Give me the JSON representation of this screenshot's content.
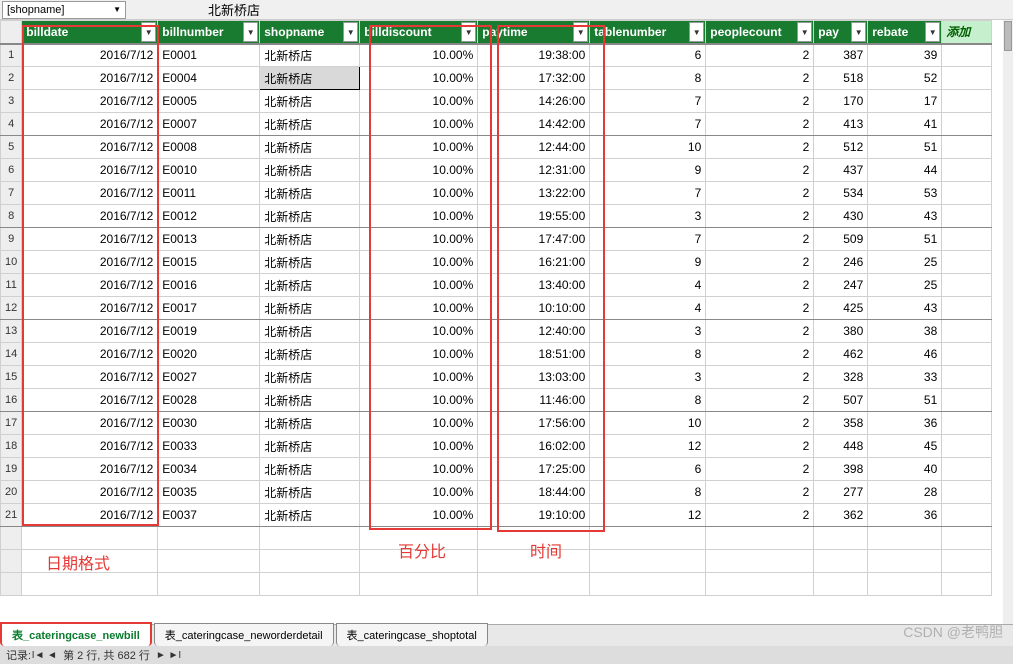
{
  "namebox": "[shopname]",
  "formula_value": "北新桥店",
  "columns": [
    {
      "key": "billdate",
      "label": "billdate"
    },
    {
      "key": "billnumber",
      "label": "billnumber"
    },
    {
      "key": "shopname",
      "label": "shopname"
    },
    {
      "key": "billdiscount",
      "label": "billdiscount"
    },
    {
      "key": "paytime",
      "label": "paytime"
    },
    {
      "key": "tablenumber",
      "label": "tablenumber"
    },
    {
      "key": "peoplecount",
      "label": "peoplecount"
    },
    {
      "key": "pay",
      "label": "pay"
    },
    {
      "key": "rebate",
      "label": "rebate"
    }
  ],
  "extra_col": "添加",
  "rows": [
    {
      "n": 1,
      "billdate": "2016/7/12",
      "billnumber": "E0001",
      "shopname": "北新桥店",
      "billdiscount": "10.00%",
      "paytime": "19:38:00",
      "tablenumber": "6",
      "peoplecount": "2",
      "pay": "387",
      "rebate": "39"
    },
    {
      "n": 2,
      "billdate": "2016/7/12",
      "billnumber": "E0004",
      "shopname": "北新桥店",
      "billdiscount": "10.00%",
      "paytime": "17:32:00",
      "tablenumber": "8",
      "peoplecount": "2",
      "pay": "518",
      "rebate": "52"
    },
    {
      "n": 3,
      "billdate": "2016/7/12",
      "billnumber": "E0005",
      "shopname": "北新桥店",
      "billdiscount": "10.00%",
      "paytime": "14:26:00",
      "tablenumber": "7",
      "peoplecount": "2",
      "pay": "170",
      "rebate": "17"
    },
    {
      "n": 4,
      "billdate": "2016/7/12",
      "billnumber": "E0007",
      "shopname": "北新桥店",
      "billdiscount": "10.00%",
      "paytime": "14:42:00",
      "tablenumber": "7",
      "peoplecount": "2",
      "pay": "413",
      "rebate": "41"
    },
    {
      "n": 5,
      "billdate": "2016/7/12",
      "billnumber": "E0008",
      "shopname": "北新桥店",
      "billdiscount": "10.00%",
      "paytime": "12:44:00",
      "tablenumber": "10",
      "peoplecount": "2",
      "pay": "512",
      "rebate": "51"
    },
    {
      "n": 6,
      "billdate": "2016/7/12",
      "billnumber": "E0010",
      "shopname": "北新桥店",
      "billdiscount": "10.00%",
      "paytime": "12:31:00",
      "tablenumber": "9",
      "peoplecount": "2",
      "pay": "437",
      "rebate": "44"
    },
    {
      "n": 7,
      "billdate": "2016/7/12",
      "billnumber": "E0011",
      "shopname": "北新桥店",
      "billdiscount": "10.00%",
      "paytime": "13:22:00",
      "tablenumber": "7",
      "peoplecount": "2",
      "pay": "534",
      "rebate": "53"
    },
    {
      "n": 8,
      "billdate": "2016/7/12",
      "billnumber": "E0012",
      "shopname": "北新桥店",
      "billdiscount": "10.00%",
      "paytime": "19:55:00",
      "tablenumber": "3",
      "peoplecount": "2",
      "pay": "430",
      "rebate": "43"
    },
    {
      "n": 9,
      "billdate": "2016/7/12",
      "billnumber": "E0013",
      "shopname": "北新桥店",
      "billdiscount": "10.00%",
      "paytime": "17:47:00",
      "tablenumber": "7",
      "peoplecount": "2",
      "pay": "509",
      "rebate": "51"
    },
    {
      "n": 10,
      "billdate": "2016/7/12",
      "billnumber": "E0015",
      "shopname": "北新桥店",
      "billdiscount": "10.00%",
      "paytime": "16:21:00",
      "tablenumber": "9",
      "peoplecount": "2",
      "pay": "246",
      "rebate": "25"
    },
    {
      "n": 11,
      "billdate": "2016/7/12",
      "billnumber": "E0016",
      "shopname": "北新桥店",
      "billdiscount": "10.00%",
      "paytime": "13:40:00",
      "tablenumber": "4",
      "peoplecount": "2",
      "pay": "247",
      "rebate": "25"
    },
    {
      "n": 12,
      "billdate": "2016/7/12",
      "billnumber": "E0017",
      "shopname": "北新桥店",
      "billdiscount": "10.00%",
      "paytime": "10:10:00",
      "tablenumber": "4",
      "peoplecount": "2",
      "pay": "425",
      "rebate": "43"
    },
    {
      "n": 13,
      "billdate": "2016/7/12",
      "billnumber": "E0019",
      "shopname": "北新桥店",
      "billdiscount": "10.00%",
      "paytime": "12:40:00",
      "tablenumber": "3",
      "peoplecount": "2",
      "pay": "380",
      "rebate": "38"
    },
    {
      "n": 14,
      "billdate": "2016/7/12",
      "billnumber": "E0020",
      "shopname": "北新桥店",
      "billdiscount": "10.00%",
      "paytime": "18:51:00",
      "tablenumber": "8",
      "peoplecount": "2",
      "pay": "462",
      "rebate": "46"
    },
    {
      "n": 15,
      "billdate": "2016/7/12",
      "billnumber": "E0027",
      "shopname": "北新桥店",
      "billdiscount": "10.00%",
      "paytime": "13:03:00",
      "tablenumber": "3",
      "peoplecount": "2",
      "pay": "328",
      "rebate": "33"
    },
    {
      "n": 16,
      "billdate": "2016/7/12",
      "billnumber": "E0028",
      "shopname": "北新桥店",
      "billdiscount": "10.00%",
      "paytime": "11:46:00",
      "tablenumber": "8",
      "peoplecount": "2",
      "pay": "507",
      "rebate": "51"
    },
    {
      "n": 17,
      "billdate": "2016/7/12",
      "billnumber": "E0030",
      "shopname": "北新桥店",
      "billdiscount": "10.00%",
      "paytime": "17:56:00",
      "tablenumber": "10",
      "peoplecount": "2",
      "pay": "358",
      "rebate": "36"
    },
    {
      "n": 18,
      "billdate": "2016/7/12",
      "billnumber": "E0033",
      "shopname": "北新桥店",
      "billdiscount": "10.00%",
      "paytime": "16:02:00",
      "tablenumber": "12",
      "peoplecount": "2",
      "pay": "448",
      "rebate": "45"
    },
    {
      "n": 19,
      "billdate": "2016/7/12",
      "billnumber": "E0034",
      "shopname": "北新桥店",
      "billdiscount": "10.00%",
      "paytime": "17:25:00",
      "tablenumber": "6",
      "peoplecount": "2",
      "pay": "398",
      "rebate": "40"
    },
    {
      "n": 20,
      "billdate": "2016/7/12",
      "billnumber": "E0035",
      "shopname": "北新桥店",
      "billdiscount": "10.00%",
      "paytime": "18:44:00",
      "tablenumber": "8",
      "peoplecount": "2",
      "pay": "277",
      "rebate": "28"
    },
    {
      "n": 21,
      "billdate": "2016/7/12",
      "billnumber": "E0037",
      "shopname": "北新桥店",
      "billdiscount": "10.00%",
      "paytime": "19:10:00",
      "tablenumber": "12",
      "peoplecount": "2",
      "pay": "362",
      "rebate": "36"
    }
  ],
  "annotations": {
    "date": "日期格式",
    "percent": "百分比",
    "time": "时间"
  },
  "tabs": [
    {
      "label": "表_cateringcase_newbill",
      "active": true
    },
    {
      "label": "表_cateringcase_neworderdetail",
      "active": false
    },
    {
      "label": "表_cateringcase_shoptotal",
      "active": false
    }
  ],
  "status": {
    "label": "记录:",
    "nav": "第 2 行, 共 682 行"
  },
  "watermark": "CSDN @老鸭胆"
}
